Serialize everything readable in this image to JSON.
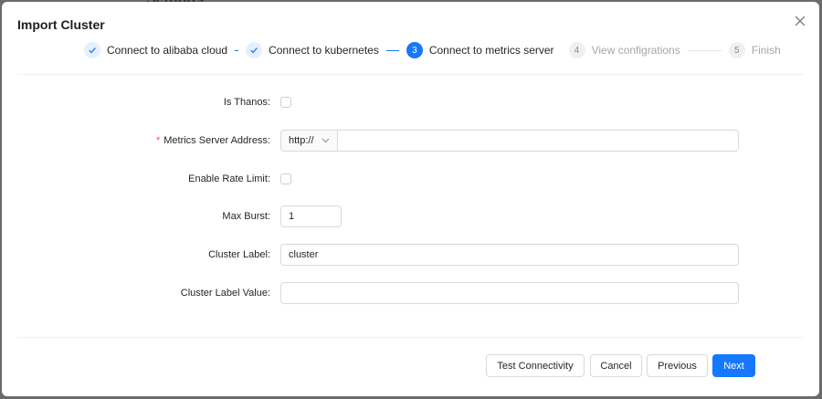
{
  "background": {
    "title": "Settings"
  },
  "modal": {
    "title": "Import Cluster"
  },
  "steps": [
    {
      "number": "1",
      "label": "Connect to alibaba cloud",
      "status": "done"
    },
    {
      "number": "2",
      "label": "Connect to kubernetes",
      "status": "done"
    },
    {
      "number": "3",
      "label": "Connect to metrics server",
      "status": "active"
    },
    {
      "number": "4",
      "label": "View configrations",
      "status": "wait"
    },
    {
      "number": "5",
      "label": "Finish",
      "status": "wait"
    }
  ],
  "form": {
    "is_thanos": {
      "label": "Is Thanos",
      "checked": false
    },
    "metrics_server_address": {
      "label": "Metrics Server Address",
      "required": true,
      "protocol": "http://",
      "value": ""
    },
    "enable_rate_limit": {
      "label": "Enable Rate Limit",
      "checked": false
    },
    "max_burst": {
      "label": "Max Burst",
      "value": "1"
    },
    "cluster_label": {
      "label": "Cluster Label",
      "value": "cluster"
    },
    "cluster_label_value": {
      "label": "Cluster Label Value",
      "value": ""
    }
  },
  "footer": {
    "test_label": "Test Connectivity",
    "cancel_label": "Cancel",
    "previous_label": "Previous",
    "next_label": "Next"
  },
  "colors": {
    "primary": "#1677ff",
    "required": "#ff4d4f"
  }
}
